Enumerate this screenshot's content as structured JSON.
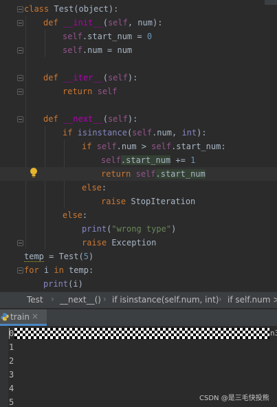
{
  "editor": {
    "lines": [
      [
        "class",
        " ",
        "Test",
        "(",
        "object",
        "):"
      ],
      [
        "def",
        " ",
        "__init__",
        "(",
        "self",
        ", num):"
      ],
      [
        "self",
        ".start_num = ",
        "0"
      ],
      [
        "self",
        ".num = num"
      ],
      [
        "def",
        " ",
        "__iter__",
        "(",
        "self",
        "):"
      ],
      [
        "return",
        " ",
        "self"
      ],
      [
        "def",
        " ",
        "__next__",
        "(",
        "self",
        "):"
      ],
      [
        "if",
        " ",
        "isinstance",
        "(",
        "self",
        ".num, ",
        "int",
        "):"
      ],
      [
        "if",
        " ",
        "self",
        ".num > ",
        "self",
        ".start_num:"
      ],
      [
        "self",
        ".start_num",
        " += ",
        "1"
      ],
      [
        "return",
        " ",
        "self",
        ".start_num"
      ],
      [
        "else",
        ":"
      ],
      [
        "raise",
        " StopIteration"
      ],
      [
        "else",
        ":"
      ],
      [
        "print",
        "(",
        "\"wrong type\"",
        ")"
      ],
      [
        "raise",
        " Exception"
      ],
      [
        "temp",
        " = Test(",
        "5",
        ")"
      ],
      [
        "for",
        " i ",
        "in",
        " temp:"
      ],
      [
        "print",
        "(i)"
      ]
    ]
  },
  "breadcrumb": {
    "items": [
      "Test",
      "__next__()",
      "if isinstance(self.num, int)",
      "if self.num >"
    ]
  },
  "run_panel": {
    "tab_label": "train",
    "close_glyph": "×",
    "output_lines": [
      "0",
      "1",
      "2",
      "3",
      "4",
      "5"
    ],
    "clipped_text": "n3"
  },
  "watermark": "CSDN @是三毛快投熊",
  "colors": {
    "keyword": "#cc7832",
    "self": "#94558d",
    "number": "#6897bb",
    "string": "#6a8759",
    "builtin": "#8888c6",
    "dunder": "#b200b2",
    "accent": "#4a88c7"
  },
  "icons": [
    "fold-marker-icon",
    "lightbulb-icon",
    "python-icon",
    "close-icon"
  ]
}
